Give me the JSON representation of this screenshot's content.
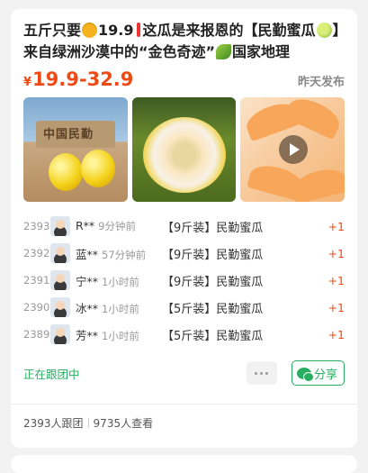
{
  "post": {
    "title_part1": "五斤只要",
    "title_part2": "19.9",
    "title_part3": "这瓜是来报恩的【民勤蜜瓜",
    "title_part4": "】来自绿洲沙漠中的“金色奇迹”",
    "title_part5": "国家地理",
    "price_currency": "¥",
    "price_range": "19.9-32.9",
    "posted_label": "昨天发布",
    "photo1_sign": "中国民勤"
  },
  "icons": {
    "money_bag": "money-bag-icon",
    "exclamation": "exclamation-icon",
    "melon": "melon-icon",
    "leaf": "leaf-icon",
    "play": "play-icon",
    "more": "more-icon",
    "wechat": "wechat-icon"
  },
  "orders": [
    {
      "no": "2393",
      "name": "R**",
      "time": "9分钟前",
      "product": "【9斤装】民勤蜜瓜",
      "qty": "+1"
    },
    {
      "no": "2392",
      "name": "蓝**",
      "time": "57分钟前",
      "product": "【9斤装】民勤蜜瓜",
      "qty": "+1"
    },
    {
      "no": "2391",
      "name": "宁**",
      "time": "1小时前",
      "product": "【9斤装】民勤蜜瓜",
      "qty": "+1"
    },
    {
      "no": "2390",
      "name": "冰**",
      "time": "1小时前",
      "product": "【5斤装】民勤蜜瓜",
      "qty": "+1"
    },
    {
      "no": "2389",
      "name": "芳**",
      "time": "1小时前",
      "product": "【5斤装】民勤蜜瓜",
      "qty": "+1"
    }
  ],
  "actions": {
    "following_label": "正在跟团中",
    "share_label": "分享"
  },
  "stats": {
    "joined": "2393人跟团",
    "viewed": "9735人查看"
  },
  "colors": {
    "price": "#f04a14",
    "green": "#27ae60"
  }
}
